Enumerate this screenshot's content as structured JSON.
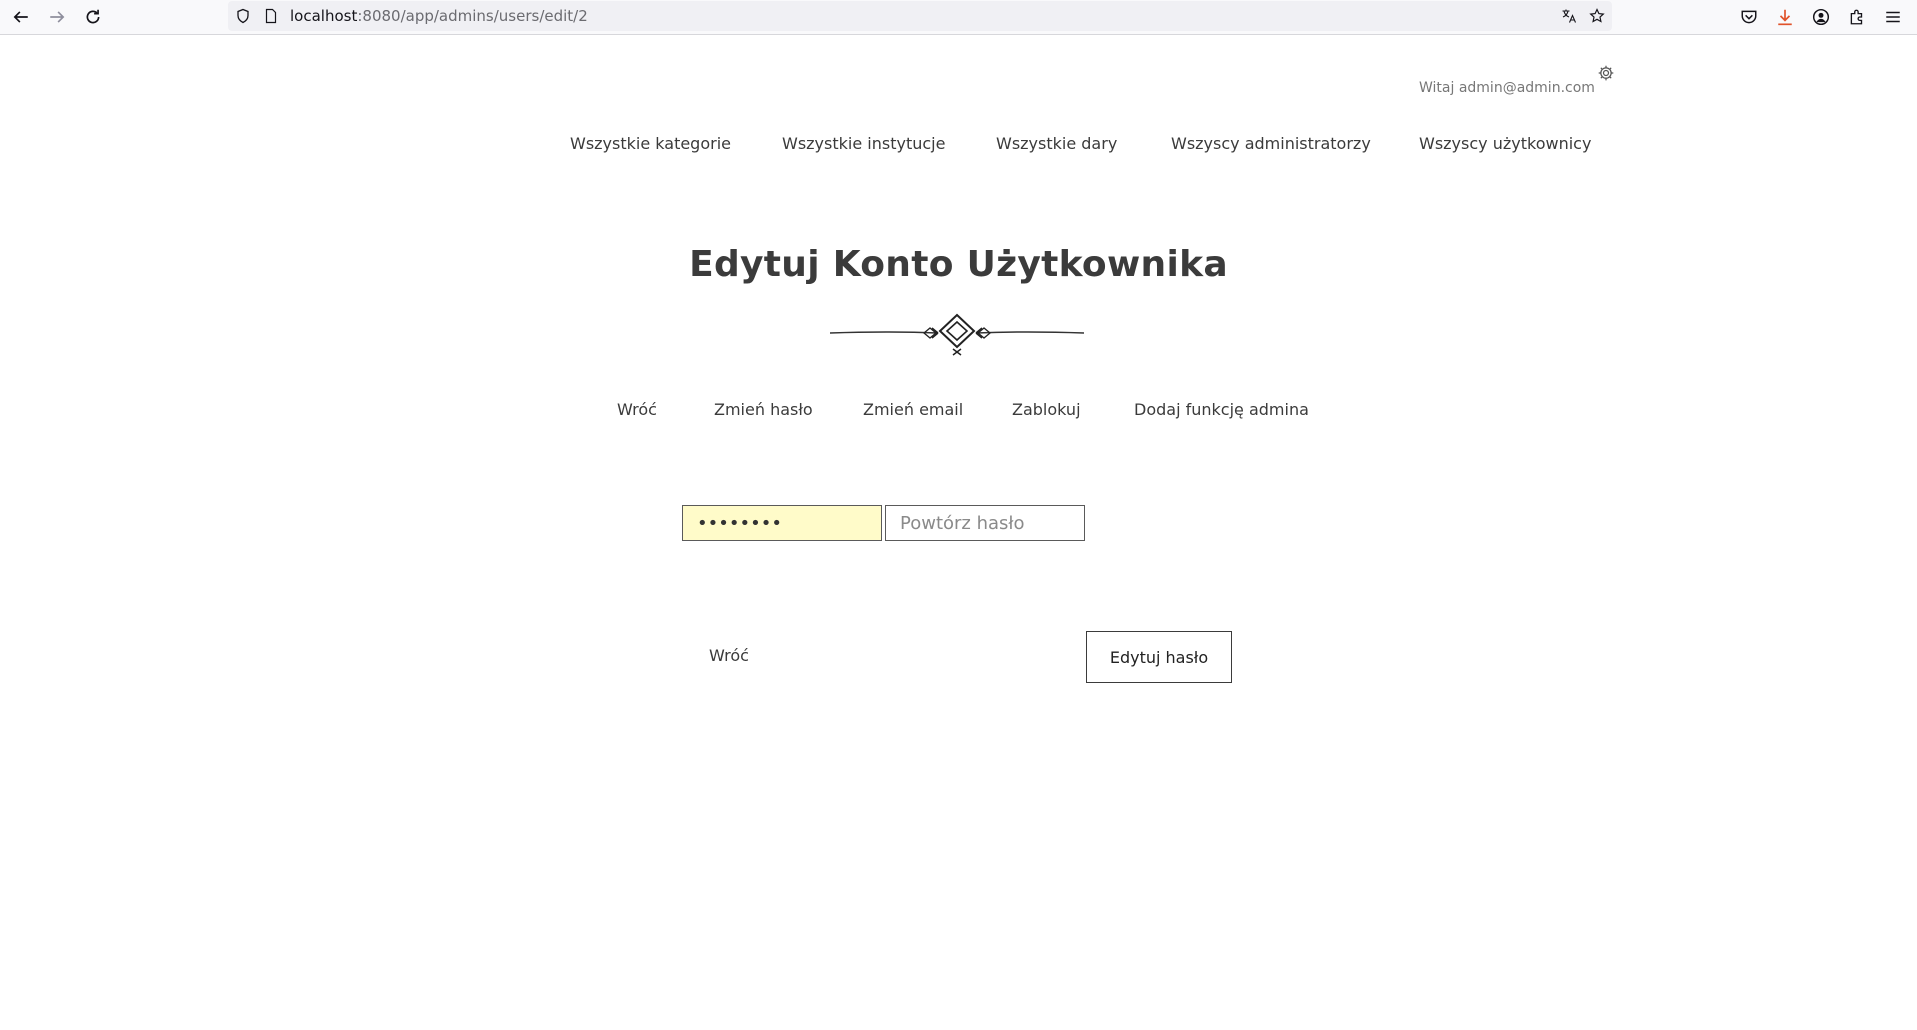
{
  "browser": {
    "url_host": "localhost",
    "url_path": ":8080/app/admins/users/edit/2",
    "icons": [
      "back-arrow-icon",
      "forward-arrow-icon",
      "reload-icon",
      "shield-icon",
      "page-icon",
      "translate-icon",
      "star-icon",
      "pocket-icon",
      "download-icon",
      "account-icon",
      "extensions-icon",
      "menu-icon"
    ]
  },
  "header": {
    "greeting": "Witaj admin@admin.com"
  },
  "nav": {
    "items": [
      "Wszystkie kategorie",
      "Wszystkie instytucje",
      "Wszystkie dary",
      "Wszyscy administratorzy",
      "Wszyscy użytkownicy"
    ]
  },
  "main": {
    "title": "Edytuj Konto Użytkownika",
    "actions": [
      "Wróć",
      "Zmień hasło",
      "Zmień email",
      "Zablokuj",
      "Dodaj funkcję admina"
    ],
    "form": {
      "password_value": "••••••••",
      "repeat_placeholder": "Powtórz hasło",
      "back_label": "Wróć",
      "submit_label": "Edytuj hasło"
    }
  },
  "colors": {
    "text": "#3b3b3b",
    "autofill_bg": "#fffbc9",
    "download_accent": "#e0532b"
  }
}
